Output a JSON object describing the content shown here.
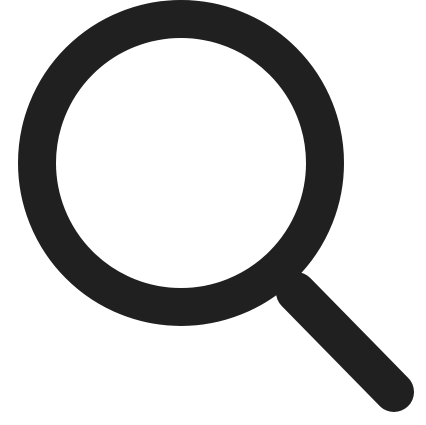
{
  "icon": {
    "name": "search-icon",
    "color": "#202020",
    "background": "#ffffff"
  }
}
